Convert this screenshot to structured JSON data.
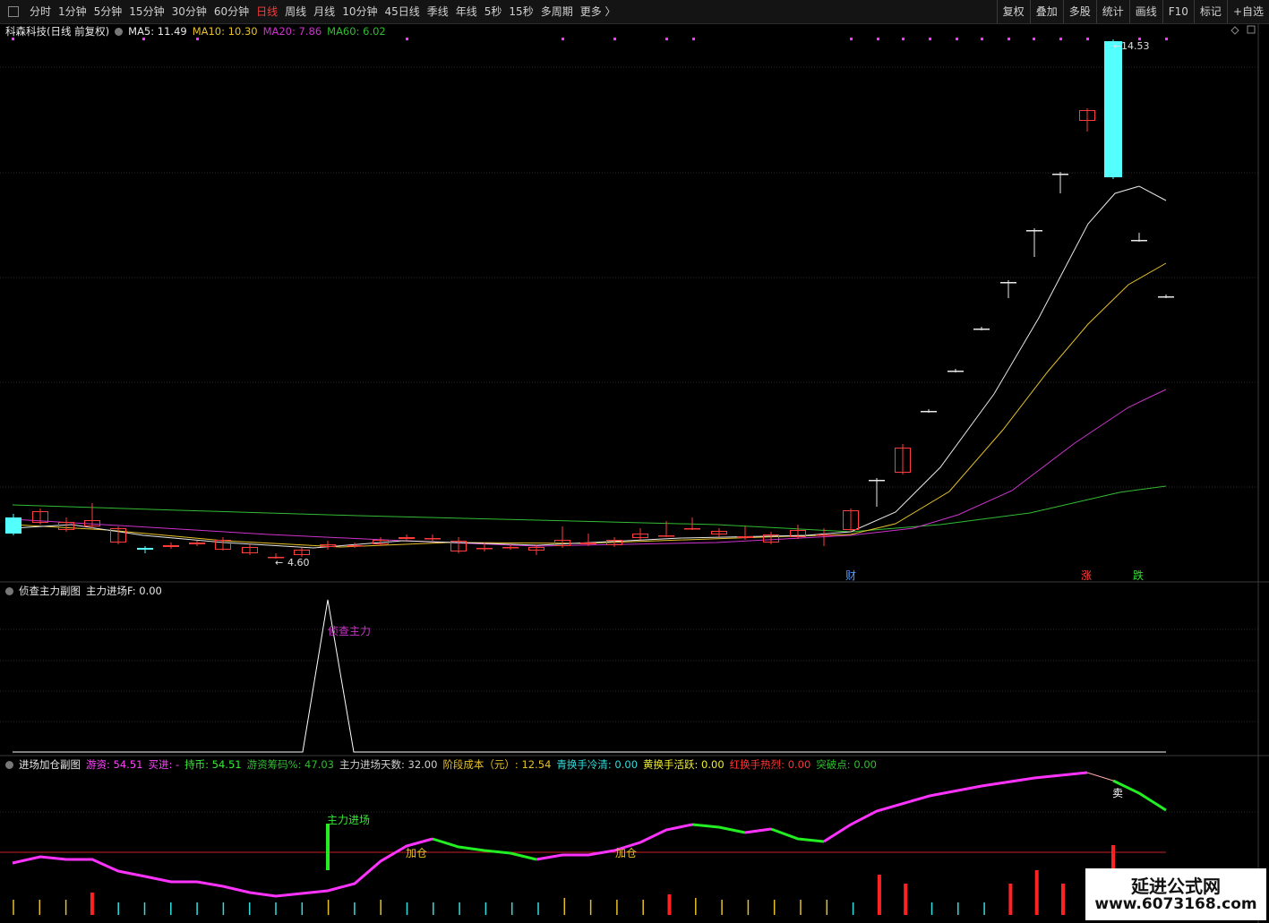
{
  "toolbar": {
    "periods": [
      "分时",
      "1分钟",
      "5分钟",
      "15分钟",
      "30分钟",
      "60分钟",
      "日线",
      "周线",
      "月线",
      "10分钟",
      "45日线",
      "季线",
      "年线",
      "5秒",
      "15秒",
      "多周期",
      "更多 〉"
    ],
    "active_period": "日线",
    "right_buttons": [
      "复权",
      "叠加",
      "多股",
      "统计",
      "画线",
      "F10",
      "标记",
      "+自选"
    ]
  },
  "main_panel": {
    "title": "科森科技(日线 前复权)",
    "ma_labels": [
      {
        "text": "MA5: 11.49",
        "color": "#e8e8e8"
      },
      {
        "text": "MA10: 10.30",
        "color": "#e6c029"
      },
      {
        "text": "MA20: 7.86",
        "color": "#cc33cc"
      },
      {
        "text": "MA60: 6.02",
        "color": "#33bb33"
      }
    ],
    "high_label": "14.53",
    "low_label": "4.60",
    "markers": [
      {
        "text": "财",
        "color": "#5599ff"
      },
      {
        "text": "涨",
        "color": "#ff4040"
      },
      {
        "text": "跌",
        "color": "#33dd33"
      }
    ]
  },
  "sub1": {
    "title": "侦查主力副图",
    "value_label": "主力进场F: 0.00",
    "annotation": "侦查主力"
  },
  "sub2": {
    "title": "进场加仓副图",
    "labels": [
      {
        "text": "游资: 54.51",
        "color": "#ff44ff"
      },
      {
        "text": "买进: -",
        "color": "#ff44ff"
      },
      {
        "text": "持币: 54.51",
        "color": "#33ee33"
      },
      {
        "text": "游资筹码%: 47.03",
        "color": "#33bb33"
      },
      {
        "text": "主力进场天数: 32.00",
        "color": "#d0d0d0"
      },
      {
        "text": "阶段成本（元）: 12.54",
        "color": "#e6c029"
      },
      {
        "text": "青换手冷清: 0.00",
        "color": "#33dddd"
      },
      {
        "text": "黄换手活跃: 0.00",
        "color": "#eeee33"
      },
      {
        "text": "红换手热烈: 0.00",
        "color": "#ff3333"
      },
      {
        "text": "突破点: 0.00",
        "color": "#33bb33"
      }
    ],
    "annotations": [
      "主力进场",
      "加仓",
      "加仓",
      "卖"
    ]
  },
  "watermark": {
    "line1": "延进公式网",
    "line2": "www.6073168.com"
  },
  "colors": {
    "up": "#ff3b3b",
    "down": "#54ffff",
    "ma5": "#e8e8e8",
    "ma10": "#e6c029",
    "ma20": "#cc33cc",
    "ma60": "#33bb33"
  }
}
